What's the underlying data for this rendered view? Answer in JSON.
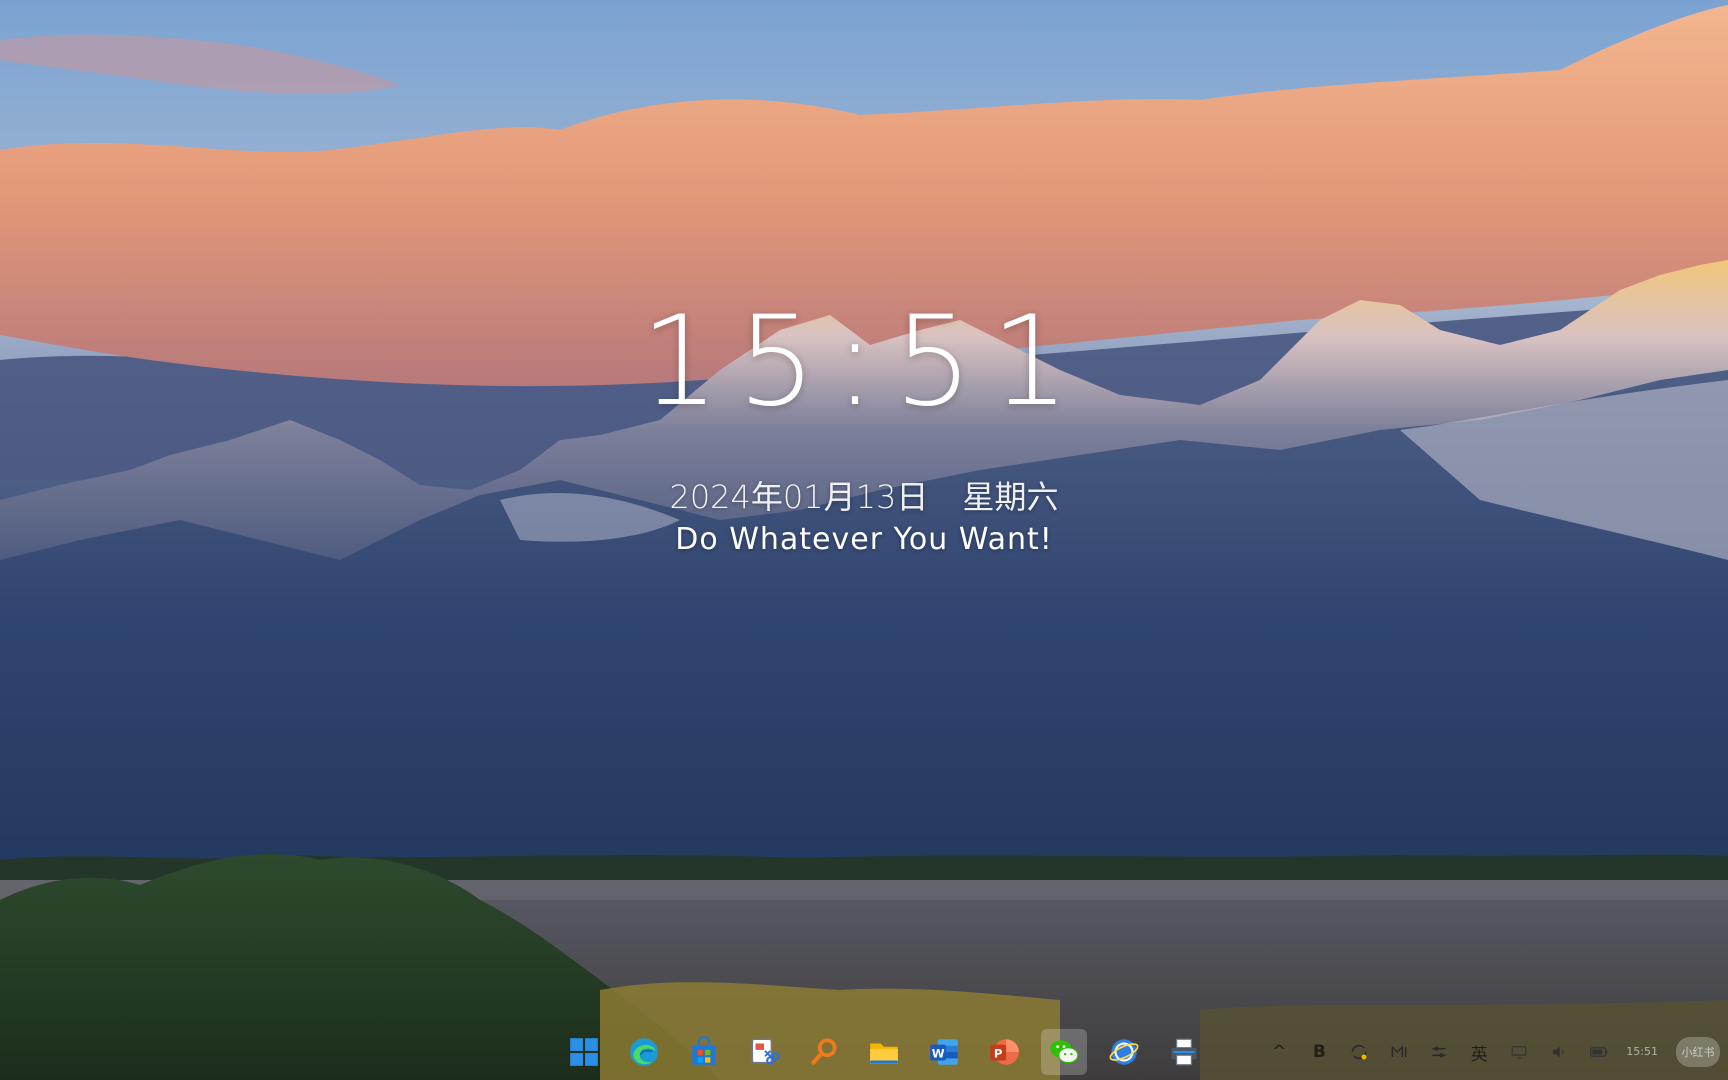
{
  "clock": {
    "time": "15:51",
    "date": "2024年01月13日",
    "weekday": "星期六",
    "motto": "Do Whatever You Want!"
  },
  "taskbar": {
    "apps": [
      {
        "name": "start-button",
        "icon": "windows-logo-icon",
        "active": false
      },
      {
        "name": "edge-button",
        "icon": "edge-browser-icon",
        "active": false
      },
      {
        "name": "store-button",
        "icon": "microsoft-store-icon",
        "active": false
      },
      {
        "name": "snipping-tool-button",
        "icon": "snipping-tool-icon",
        "active": false
      },
      {
        "name": "search-button",
        "icon": "search-icon",
        "active": false
      },
      {
        "name": "file-explorer-button",
        "icon": "folder-icon",
        "active": false
      },
      {
        "name": "word-button",
        "icon": "word-icon",
        "active": false
      },
      {
        "name": "powerpoint-button",
        "icon": "powerpoint-icon",
        "active": false
      },
      {
        "name": "wechat-button",
        "icon": "wechat-icon",
        "active": true
      },
      {
        "name": "browser-globe-button",
        "icon": "globe-browser-icon",
        "active": false
      },
      {
        "name": "printer-button",
        "icon": "printer-icon",
        "active": false
      }
    ],
    "tray": {
      "chevron": "^",
      "bold": "B",
      "ime": "英",
      "clock_time": "15:51",
      "clock_date": "小红书"
    }
  },
  "colors": {
    "sky": "#7fa6cf",
    "cloud": "#e9a27b",
    "mountain": "#2e4471",
    "clock_text": "#ffffff"
  }
}
